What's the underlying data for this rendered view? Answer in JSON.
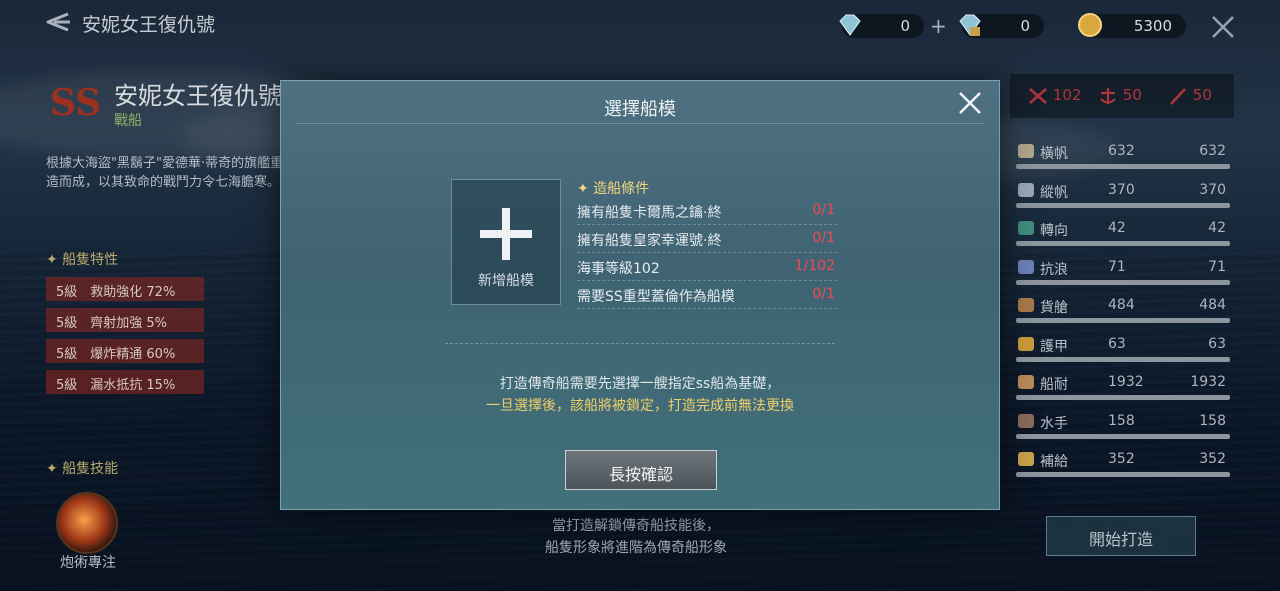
{
  "header": {
    "title": "安妮女王復仇號"
  },
  "currencies": [
    {
      "icon": "diamond-icon",
      "value": "0"
    },
    {
      "icon": "locked-diamond-icon",
      "value": "0"
    },
    {
      "icon": "gold-coin-icon",
      "value": "5300"
    }
  ],
  "ship": {
    "rank": "SS",
    "name": "安妮女王復仇號",
    "type": "戰船",
    "description": "根據大海盜\"黑鬍子\"愛德華·蒂奇的旗艦重造而成，以其致命的戰鬥力令七海膽寒。"
  },
  "traits": {
    "title": "船隻特性",
    "items": [
      {
        "label": "5級　救助強化 72%"
      },
      {
        "label": "5級　齊射加強 5%"
      },
      {
        "label": "5級　爆炸精通 60%"
      },
      {
        "label": "5級　漏水抵抗 15%"
      }
    ]
  },
  "skills": {
    "title": "船隻技能",
    "items": [
      {
        "label": "炮術專注"
      }
    ]
  },
  "attack": [
    {
      "icon": "crossed-swords-icon",
      "value": "102"
    },
    {
      "icon": "anchor-icon",
      "value": "50"
    },
    {
      "icon": "quill-icon",
      "value": "50"
    }
  ],
  "stats": [
    {
      "name": "橫帆",
      "value": "632",
      "max": "632",
      "color": "#b0a48a"
    },
    {
      "name": "縱帆",
      "value": "370",
      "max": "370",
      "color": "#9aa6b4"
    },
    {
      "name": "轉向",
      "value": "42",
      "max": "42",
      "color": "#3e8d7a"
    },
    {
      "name": "抗浪",
      "value": "71",
      "max": "71",
      "color": "#6c7fb6"
    },
    {
      "name": "貨艙",
      "value": "484",
      "max": "484",
      "color": "#a67a4a"
    },
    {
      "name": "護甲",
      "value": "63",
      "max": "63",
      "color": "#c89a3a"
    },
    {
      "name": "船耐",
      "value": "1932",
      "max": "1932",
      "color": "#b88a5a"
    },
    {
      "name": "水手",
      "value": "158",
      "max": "158",
      "color": "#8a6a5a"
    },
    {
      "name": "補給",
      "value": "352",
      "max": "352",
      "color": "#c8a24a"
    }
  ],
  "start_button": "開始打造",
  "bottom_note": {
    "line1": "當打造解鎖傳奇船技能後，",
    "line2": "船隻形象將進階為傳奇船形象"
  },
  "modal": {
    "title": "選擇船模",
    "add_label": "新增船模",
    "conditions_title": "造船條件",
    "conditions": [
      {
        "text": "擁有船隻卡爾馬之鑰·終",
        "value": "0/1"
      },
      {
        "text": "擁有船隻皇家幸運號·終",
        "value": "0/1"
      },
      {
        "text": "海事等級102",
        "value": "1/102"
      },
      {
        "text": "需要SS重型蓋倫作為船模",
        "value": "0/1"
      }
    ],
    "note1": "打造傳奇船需要先選擇一艘指定ss船為基礎，",
    "note2": "一旦選擇後，該船將被鎖定，打造完成前無法更換",
    "confirm_label": "長按確認"
  }
}
